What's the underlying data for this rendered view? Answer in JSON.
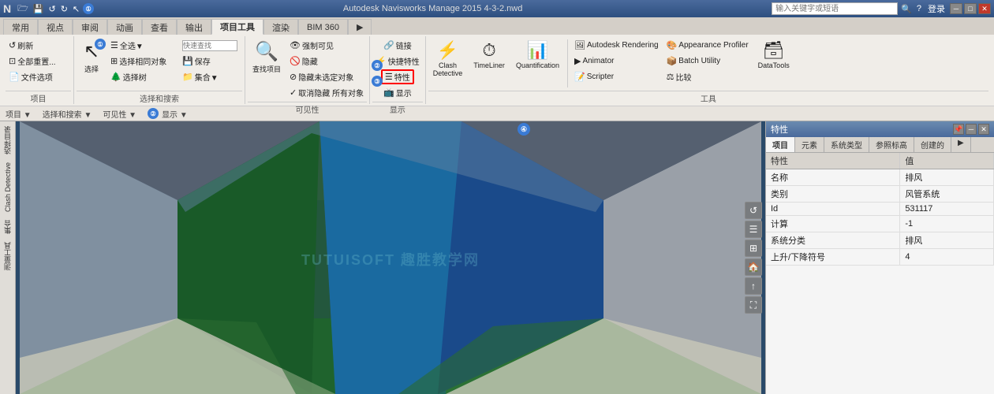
{
  "titlebar": {
    "title": "Autodesk Navisworks Manage 2015  4-3-2.nwd",
    "search_placeholder": "输入关键字或短语",
    "help": "?",
    "login": "登录"
  },
  "ribbon": {
    "tabs": [
      "常用",
      "视点",
      "审阅",
      "动画",
      "查看",
      "输出",
      "项目工具",
      "渲染",
      "BIM 360",
      "▶"
    ],
    "active_tab": "项目工具",
    "groups": {
      "project": {
        "label": "项目",
        "buttons": [
          "刷新",
          "全部重置...",
          "文件选项"
        ]
      },
      "select": {
        "label": "选择和搜索",
        "select_btn": "选择",
        "save_btn": "保存",
        "select_same": "选择相同对象",
        "quick_find": "快速查找",
        "select_all": "全选▼",
        "select_tree": "选择树",
        "sets": "集合▼",
        "search_box": ""
      },
      "visibility": {
        "label": "可见性",
        "find_items": "查找项目",
        "force_visible": "强制可见",
        "hide": "隐藏",
        "hide_unselected": "隐藏未选定对象",
        "unhide_all": "取消隐藏 所有对象"
      },
      "properties": {
        "label": "显示",
        "link": "链接",
        "quick_props": "快捷特性",
        "properties": "特性",
        "display": "显示"
      },
      "tools": {
        "label": "工具",
        "clash": "Clash\nDetective",
        "timeliner": "TimeLiner",
        "quantification": "Quantification",
        "animator": "Animator",
        "scripter": "Scripter",
        "autodesk_rendering": "Autodesk Rendering",
        "appearance_profiler": "Appearance Profiler",
        "batch_utility": "Batch Utility",
        "compare": "比较",
        "data_tools": "DataTools"
      }
    }
  },
  "subbar": {
    "items": [
      "项目 ▼",
      "选择和搜索 ▼",
      "可见性 ▼",
      "② 显示 ▼"
    ]
  },
  "left_sidebar": {
    "items": [
      "选择目录",
      "Clash Detective",
      "集合",
      "测量工具"
    ]
  },
  "viewport": {
    "watermark": "TUTUISOFT 趣胜教学网"
  },
  "right_panel": {
    "title": "特性",
    "tabs": [
      "项目",
      "元素",
      "系统类型",
      "参照标高",
      "创建的",
      "▶"
    ],
    "active_tab": "项目",
    "columns": [
      "特性",
      "值"
    ],
    "rows": [
      {
        "property": "名称",
        "value": "排风"
      },
      {
        "property": "类别",
        "value": "风管系统"
      },
      {
        "property": "Id",
        "value": "531117"
      },
      {
        "property": "计算",
        "value": "-1"
      },
      {
        "property": "系统分类",
        "value": "排风"
      },
      {
        "property": "上升/下降符号",
        "value": "4"
      }
    ]
  },
  "badges": [
    {
      "id": "1",
      "label": "①"
    },
    {
      "id": "2",
      "label": "②"
    },
    {
      "id": "3",
      "label": "③"
    },
    {
      "id": "4",
      "label": "④"
    }
  ],
  "icons": {
    "refresh": "↺",
    "reset": "⊡",
    "file": "📄",
    "select": "↖",
    "save": "💾",
    "search": "🔍",
    "eye": "👁",
    "link": "🔗",
    "properties": "☰",
    "clash": "⚡",
    "time": "⏱",
    "quant": "📊",
    "anim": "▶",
    "script": "📝",
    "render": "🖼",
    "appearance": "🎨",
    "batch": "📦",
    "compare": "⚖",
    "data": "🗃",
    "close": "✕",
    "minimize": "─",
    "maximize": "□",
    "pin": "📌",
    "arrow_down": "▼",
    "triangle": "▶"
  }
}
